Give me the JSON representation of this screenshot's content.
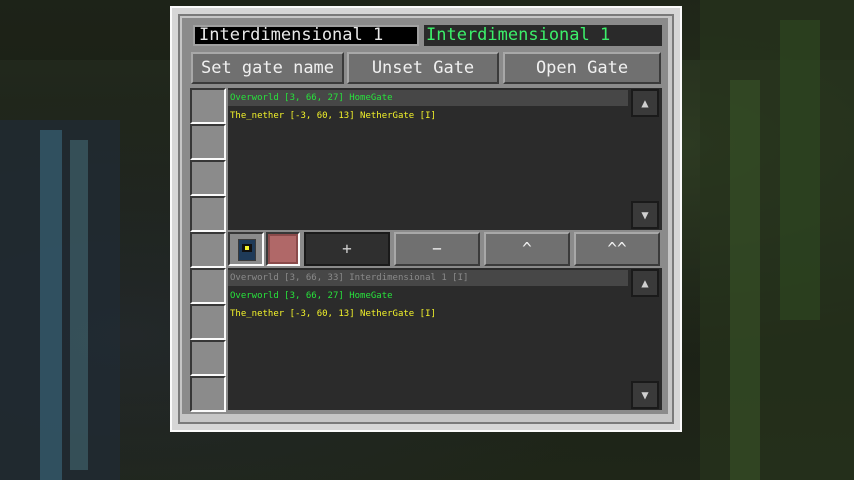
{
  "gate": {
    "name_input_value": "Interdimensional 1",
    "name_label": "Interdimensional 1"
  },
  "toolbar": {
    "set_name": "Set gate name",
    "unset": "Unset Gate",
    "open": "Open Gate"
  },
  "destinations": [
    {
      "text": "Overworld [3, 66, 27] HomeGate",
      "color": "green",
      "selected": true
    },
    {
      "text": "The_nether [-3, 60, 13] NetherGate [I]",
      "color": "yellow",
      "selected": false
    }
  ],
  "known_gates": [
    {
      "text": "Overworld [3, 66, 33] Interdimensional 1 [I]",
      "color": "gray",
      "selected": true
    },
    {
      "text": "Overworld [3, 66, 27] HomeGate",
      "color": "green",
      "selected": false
    },
    {
      "text": "The_nether [-3, 60, 13] NetherGate [I]",
      "color": "yellow",
      "selected": false
    }
  ],
  "controls": {
    "add": "+",
    "remove": "−",
    "up": "^",
    "top": "^^"
  },
  "scroll": {
    "up_glyph": "▲",
    "down_glyph": "▼"
  },
  "colors": {
    "green": "#28e23c",
    "yellow": "#f2f22a",
    "gray": "#8a8a8a",
    "label_green": "#3cf06a"
  },
  "icons": {
    "gate_item": "dial-device-icon",
    "scroll_up": "arrow-up-icon",
    "scroll_down": "arrow-down-icon"
  }
}
